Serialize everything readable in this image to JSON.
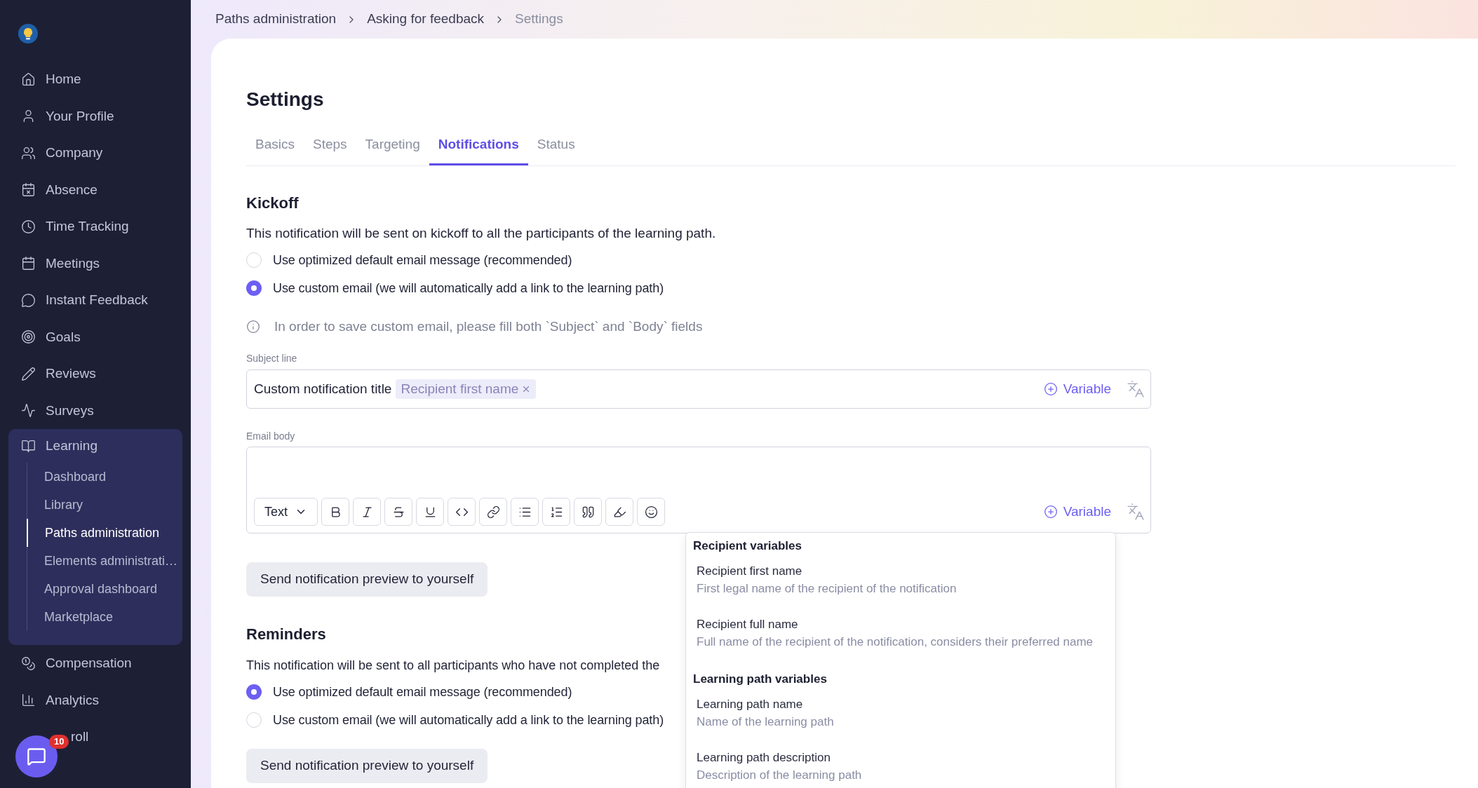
{
  "sidebar": {
    "items": [
      {
        "label": "Home"
      },
      {
        "label": "Your Profile"
      },
      {
        "label": "Company"
      },
      {
        "label": "Absence"
      },
      {
        "label": "Time Tracking"
      },
      {
        "label": "Meetings"
      },
      {
        "label": "Instant Feedback"
      },
      {
        "label": "Goals"
      },
      {
        "label": "Reviews"
      },
      {
        "label": "Surveys"
      },
      {
        "label": "Learning",
        "expanded": true,
        "children": [
          {
            "label": "Dashboard",
            "selected": false
          },
          {
            "label": "Library",
            "selected": false
          },
          {
            "label": "Paths administration",
            "selected": true
          },
          {
            "label": "Elements administrati…",
            "selected": false
          },
          {
            "label": "Approval dashboard",
            "selected": false
          },
          {
            "label": "Marketplace",
            "selected": false
          }
        ]
      },
      {
        "label": "Compensation"
      },
      {
        "label": "Analytics"
      },
      {
        "label": "roll"
      }
    ]
  },
  "chat_badge": "10",
  "breadcrumb": [
    "Paths administration",
    "Asking for feedback",
    "Settings"
  ],
  "page_title": "Settings",
  "tabs": [
    {
      "label": "Basics",
      "selected": false
    },
    {
      "label": "Steps",
      "selected": false
    },
    {
      "label": "Targeting",
      "selected": false
    },
    {
      "label": "Notifications",
      "selected": true
    },
    {
      "label": "Status",
      "selected": false
    }
  ],
  "kickoff": {
    "title": "Kickoff",
    "description": "This notification will be sent on kickoff to all the participants of the learning path.",
    "options": [
      {
        "label": "Use optimized default email message (recommended)",
        "selected": false
      },
      {
        "label": "Use custom email (we will automatically add a link to the learning path)",
        "selected": true
      }
    ],
    "info": "In order to save custom email, please fill both `Subject` and `Body` fields",
    "subject_label": "Subject line",
    "subject_text": "Custom notification title",
    "subject_tokens": [
      "Recipient first name"
    ],
    "variable_button": "Variable",
    "body_label": "Email body",
    "text_style": "Text",
    "body_variable_button": "Variable",
    "preview_button": "Send notification preview to yourself"
  },
  "reminders": {
    "title": "Reminders",
    "description": "This notification will be sent to all participants who have not completed the",
    "options": [
      {
        "label": "Use optimized default email message (recommended)",
        "selected": true
      },
      {
        "label": "Use custom email (we will automatically add a link to the learning path)",
        "selected": false
      }
    ],
    "preview_button": "Send notification preview to yourself"
  },
  "variables_menu": [
    {
      "title": "Recipient variables",
      "items": [
        {
          "name": "Recipient first name",
          "description": "First legal name of the recipient of the notification"
        },
        {
          "name": "Recipient full name",
          "description": "Full name of the recipient of the notification, considers their preferred name"
        }
      ]
    },
    {
      "title": "Learning path variables",
      "items": [
        {
          "name": "Learning path name",
          "description": "Name of the learning path"
        },
        {
          "name": "Learning path description",
          "description": "Description of the learning path"
        }
      ]
    }
  ]
}
